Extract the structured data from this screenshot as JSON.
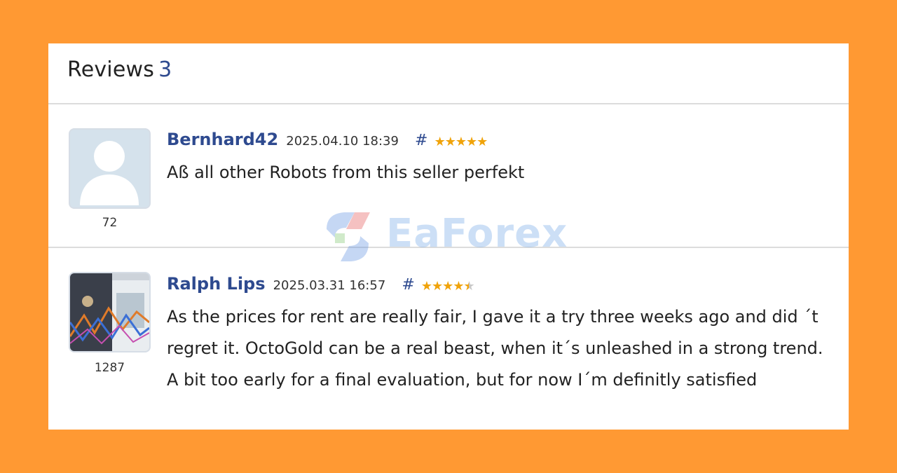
{
  "header": {
    "title": "Reviews",
    "count": "3"
  },
  "reviews": [
    {
      "author": "Bernhard42",
      "date": "2025.04.10 18:39",
      "hash": "#",
      "rating": 5,
      "avatar_count": "72",
      "text": "Aß all other Robots from this seller perfekt"
    },
    {
      "author": "Ralph Lips",
      "date": "2025.03.31 16:57",
      "hash": "#",
      "rating": 4.5,
      "avatar_count": "1287",
      "text": "As the prices for rent are really fair, I gave it a try three weeks ago and did ´t regret it. OctoGold can be a real beast, when it´s unleashed in a strong trend. A bit too early for a final evaluation, but for now I´m definitly satisfied"
    }
  ],
  "watermark": {
    "text": "EaForex"
  },
  "colors": {
    "background": "#ff9933",
    "link": "#2e4a8f",
    "star": "#f0a30a"
  }
}
